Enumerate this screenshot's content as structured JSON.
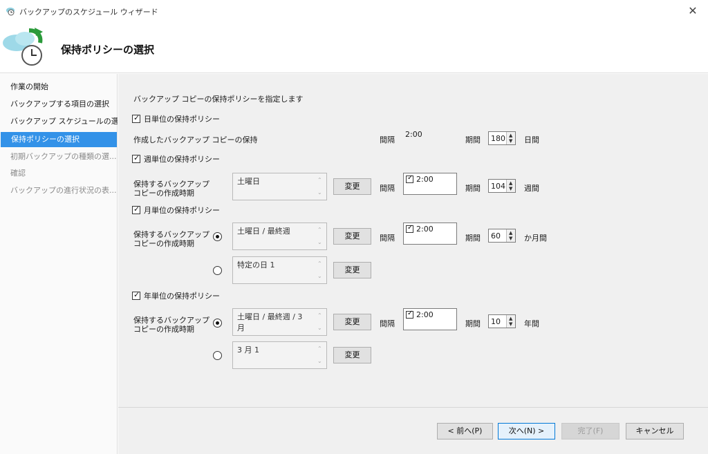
{
  "window": {
    "title": "バックアップのスケジュール ウィザード",
    "close_glyph": "✕"
  },
  "header": {
    "title": "保持ポリシーの選択"
  },
  "sidebar": {
    "items": [
      {
        "label": "作業の開始"
      },
      {
        "label": "バックアップする項目の選択"
      },
      {
        "label": "バックアップ スケジュールの選択"
      },
      {
        "label": "保持ポリシーの選択"
      },
      {
        "label": "初期バックアップの種類の選..."
      },
      {
        "label": "確認"
      },
      {
        "label": "バックアップの進行状況の表..."
      }
    ]
  },
  "main": {
    "intro": "バックアップ コピーの保持ポリシーを指定します",
    "labels": {
      "interval": "間隔",
      "period": "期間",
      "change": "変更",
      "keep_when": [
        "保持するバックアップ",
        "コピーの作成時期"
      ]
    },
    "daily": {
      "title": "日単位の保持ポリシー",
      "keep_label": "作成したバックアップ コピーの保持",
      "time": "2:00",
      "period_value": "180",
      "period_unit": "日間"
    },
    "weekly": {
      "title": "週単位の保持ポリシー",
      "day": "土曜日",
      "time": "2:00",
      "period_value": "104",
      "period_unit": "週間"
    },
    "monthly": {
      "title": "月単位の保持ポリシー",
      "option1": "土曜日 / 最終週",
      "option2": "特定の日 1",
      "time": "2:00",
      "period_value": "60",
      "period_unit": "か月間"
    },
    "yearly": {
      "title": "年単位の保持ポリシー",
      "option1_line1": "土曜日 / 最終週 / 3",
      "option1_line2": "月",
      "option2": "3 月 1",
      "time": "2:00",
      "period_value": "10",
      "period_unit": "年間"
    }
  },
  "footer": {
    "back": "< 前へ(P)",
    "next": "次へ(N) >",
    "finish": "完了(F)",
    "cancel": "キャンセル"
  },
  "colors": {
    "accent": "#3392e8",
    "content_bg": "#f0f0f0"
  }
}
